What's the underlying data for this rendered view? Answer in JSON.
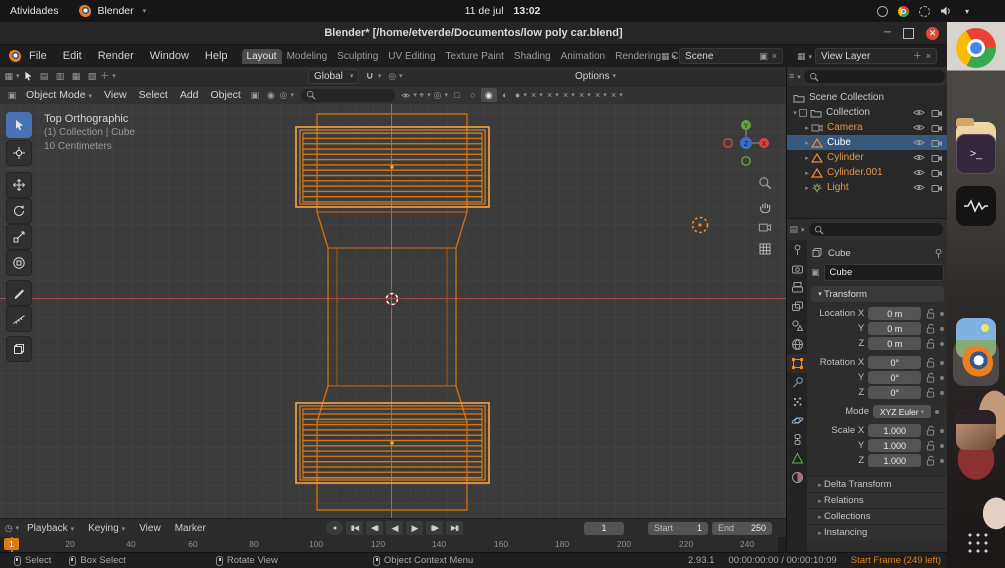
{
  "gnome": {
    "activities": "Atividades",
    "app_name": "Blender",
    "date": "11 de jul",
    "time": "13:02"
  },
  "window": {
    "title": "Blender* [/home/etverde/Documentos/low poly car.blend]"
  },
  "topbar": {
    "menus": [
      "File",
      "Edit",
      "Render",
      "Window",
      "Help"
    ],
    "workspaces": [
      "Layout",
      "Modeling",
      "Sculpting",
      "UV Editing",
      "Texture Paint",
      "Shading",
      "Animation",
      "Rendering",
      "Compositing"
    ],
    "scene": "Scene",
    "view_layer": "View Layer"
  },
  "tool_settings": {
    "orientation": "Global",
    "options": "Options"
  },
  "view_header": {
    "mode": "Object Mode",
    "menus": [
      "View",
      "Select",
      "Add",
      "Object"
    ]
  },
  "viewport": {
    "view_name": "Top Orthographic",
    "context": "(1) Collection | Cube",
    "scale": "10 Centimeters"
  },
  "outliner": {
    "scene_collection": "Scene Collection",
    "collection": "Collection",
    "objects": [
      {
        "name": "Camera",
        "icon": "camera-icon"
      },
      {
        "name": "Cube",
        "icon": "mesh-icon"
      },
      {
        "name": "Cylinder",
        "icon": "mesh-icon"
      },
      {
        "name": "Cylinder.001",
        "icon": "mesh-icon"
      },
      {
        "name": "Light",
        "icon": "light-icon"
      }
    ]
  },
  "properties": {
    "breadcrumb": "Cube",
    "name_field": "Cube",
    "transform_title": "Transform",
    "loc_labels": [
      "Location X",
      "Y",
      "Z"
    ],
    "loc_values": [
      "0 m",
      "0 m",
      "0 m"
    ],
    "rot_labels": [
      "Rotation X",
      "Y",
      "Z"
    ],
    "rot_values": [
      "0°",
      "0°",
      "0°"
    ],
    "mode_label": "Mode",
    "mode_value": "XYZ Euler",
    "scale_labels": [
      "Scale X",
      "Y",
      "Z"
    ],
    "scale_values": [
      "1.000",
      "1.000",
      "1.000"
    ],
    "sections": [
      "Delta Transform",
      "Relations",
      "Collections",
      "Instancing"
    ]
  },
  "timeline": {
    "menus": [
      "Playback",
      "Keying",
      "View",
      "Marker"
    ],
    "current_frame": "1",
    "start_label": "Start",
    "start_value": "1",
    "end_label": "End",
    "end_value": "250",
    "playhead": "1",
    "ticks": [
      "20",
      "40",
      "60",
      "80",
      "100",
      "120",
      "140",
      "160",
      "180",
      "200",
      "220",
      "240"
    ]
  },
  "status": {
    "hints": [
      "Select",
      "Box Select",
      "Rotate View",
      "Object Context Menu"
    ],
    "version": "2.93.1",
    "frame_time": "00:00:00:00 / 00:00:10:09",
    "message": "Start Frame (249 left)"
  },
  "colors": {
    "accent_orange": "#e8830c",
    "selection_blue": "#4772b3",
    "wire_selected": "#ff9f3c",
    "wire_body": "#c96c0e"
  }
}
